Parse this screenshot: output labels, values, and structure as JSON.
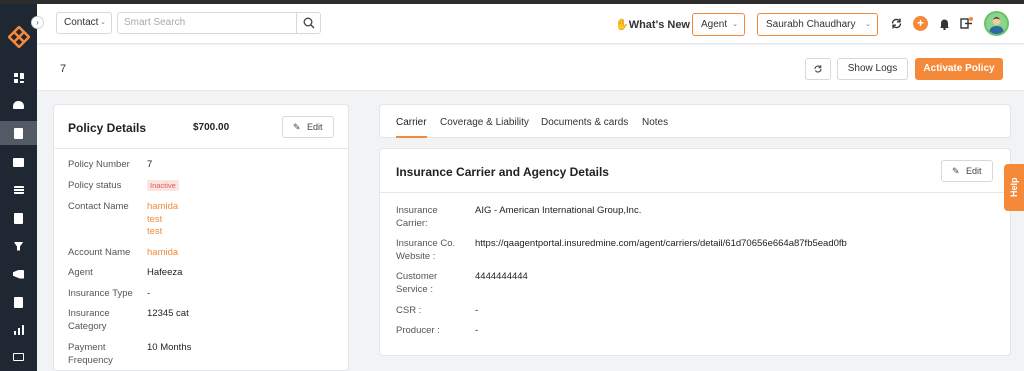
{
  "header": {
    "contact_select": "Contact",
    "search_placeholder": "Smart Search",
    "whats_new": "What's New",
    "role_select": "Agent",
    "user_select": "Saurabh Chaudhary",
    "plus_label": "+"
  },
  "subbar": {
    "record_id": "7",
    "show_logs": "Show Logs",
    "activate_policy": "Activate Policy"
  },
  "policy": {
    "title": "Policy Details",
    "amount": "$700.00",
    "edit_label": "Edit",
    "fields": [
      {
        "label": "Policy Number",
        "value": "7"
      },
      {
        "label": "Policy status",
        "value": "Inactive"
      },
      {
        "label": "Contact Name",
        "value_lines": [
          "hamida",
          "test",
          "test"
        ]
      },
      {
        "label": "Account Name",
        "value": "hamida"
      },
      {
        "label": "Agent",
        "value": "Hafeeza"
      },
      {
        "label": "Insurance Type",
        "value": "-"
      },
      {
        "label_lines": [
          "Insurance",
          "Category"
        ],
        "value": "12345 cat"
      },
      {
        "label_lines": [
          "Payment",
          "Frequency"
        ],
        "value": "10 Months"
      }
    ]
  },
  "tabs": [
    {
      "label": "Carrier",
      "active": true
    },
    {
      "label": "Coverage & Liability"
    },
    {
      "label": "Documents & cards"
    },
    {
      "label": "Notes"
    }
  ],
  "carrier": {
    "title": "Insurance Carrier and Agency Details",
    "edit_label": "Edit",
    "fields": [
      {
        "label_lines": [
          "Insurance",
          "Carrier:"
        ],
        "value": "AIG - American International Group,Inc."
      },
      {
        "label_lines": [
          "Insurance Co.",
          "Website :"
        ],
        "value": "https://qaagentportal.insuredmine.com/agent/carriers/detail/61d70656e664a87fb5ead0fb"
      },
      {
        "label_lines": [
          "Customer",
          "Service :"
        ],
        "value": "4444444444"
      },
      {
        "label": "CSR :",
        "value": "-"
      },
      {
        "label": "Producer :",
        "value": "-"
      }
    ]
  },
  "help_label": "Help",
  "colors": {
    "accent": "#f5893a",
    "sidebar": "#1f2733",
    "inactive_badge_bg": "#fde3e1",
    "inactive_badge_text": "#e05a4f"
  },
  "icons": [
    "logo-icon",
    "dashboard-icon",
    "contacts-icon",
    "policies-icon",
    "bank-icon",
    "list-icon",
    "contact-card-icon",
    "funnel-icon",
    "megaphone-icon",
    "document-icon",
    "reports-icon",
    "folder-icon",
    "search-icon",
    "refresh-icon",
    "bell-icon",
    "exit-icon",
    "pencil-icon"
  ]
}
